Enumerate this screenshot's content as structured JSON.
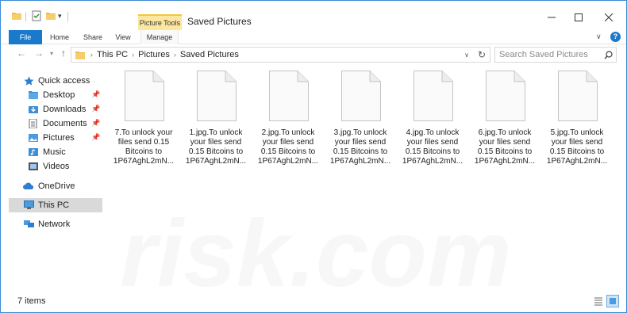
{
  "titlebar": {
    "context_tab": "Picture Tools",
    "title": "Saved Pictures"
  },
  "ribbon": {
    "tabs": [
      "File",
      "Home",
      "Share",
      "View",
      "Manage"
    ]
  },
  "address": {
    "crumbs": [
      "This PC",
      "Pictures",
      "Saved Pictures"
    ]
  },
  "search": {
    "placeholder": "Search Saved Pictures"
  },
  "navpane": {
    "quick_access": "Quick access",
    "items": [
      "Desktop",
      "Downloads",
      "Documents",
      "Pictures",
      "Music",
      "Videos"
    ],
    "onedrive": "OneDrive",
    "thispc": "This PC",
    "network": "Network"
  },
  "files": [
    {
      "lines": [
        "7.To unlock your",
        "files send 0.15",
        "Bitcoins to",
        "1P67AghL2mN..."
      ]
    },
    {
      "lines": [
        "1.jpg.To unlock",
        "your files send",
        "0.15 Bitcoins to",
        "1P67AghL2mN..."
      ]
    },
    {
      "lines": [
        "2.jpg.To unlock",
        "your files send",
        "0.15 Bitcoins to",
        "1P67AghL2mN..."
      ]
    },
    {
      "lines": [
        "3.jpg.To unlock",
        "your files send",
        "0.15 Bitcoins to",
        "1P67AghL2mN..."
      ]
    },
    {
      "lines": [
        "4.jpg.To unlock",
        "your files send",
        "0.15 Bitcoins to",
        "1P67AghL2mN..."
      ]
    },
    {
      "lines": [
        "6.jpg.To unlock",
        "your files send",
        "0.15 Bitcoins to",
        "1P67AghL2mN..."
      ]
    },
    {
      "lines": [
        "5.jpg.To unlock",
        "your files send",
        "0.15 Bitcoins to",
        "1P67AghL2mN..."
      ]
    }
  ],
  "status": {
    "count": "7 items"
  },
  "watermark": "risk.com",
  "colors": {
    "accent": "#1979ca",
    "context": "#fbe7a0",
    "selection": "#d9d9d9"
  }
}
